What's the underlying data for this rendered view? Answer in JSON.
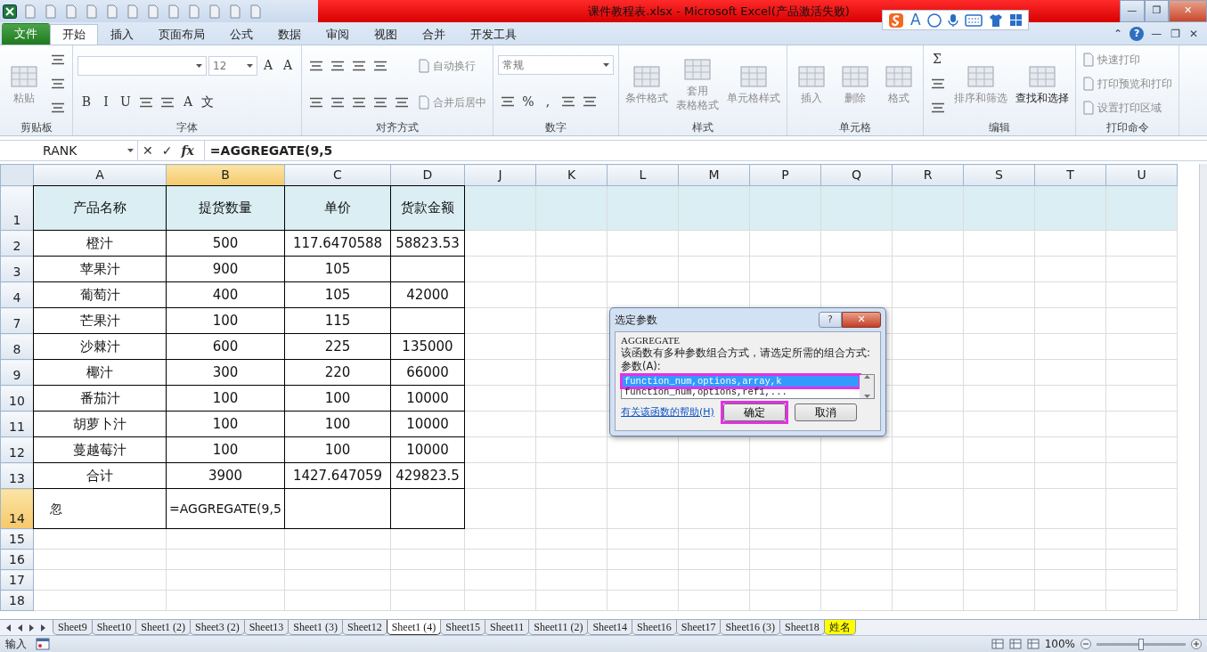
{
  "title_bar": {
    "title": "课件教程表.xlsx - Microsoft Excel(产品激活失败)",
    "controls": [
      "—",
      "❐",
      "✕"
    ]
  },
  "ime_toolbar": {
    "label": "A"
  },
  "ribbon_tabs": [
    {
      "label": "文件",
      "kind": "file",
      "selected": false
    },
    {
      "label": "开始",
      "kind": "tab",
      "selected": true
    },
    {
      "label": "插入",
      "kind": "tab",
      "selected": false
    },
    {
      "label": "页面布局",
      "kind": "tab",
      "selected": false
    },
    {
      "label": "公式",
      "kind": "tab",
      "selected": false
    },
    {
      "label": "数据",
      "kind": "tab",
      "selected": false
    },
    {
      "label": "审阅",
      "kind": "tab",
      "selected": false
    },
    {
      "label": "视图",
      "kind": "tab",
      "selected": false
    },
    {
      "label": "合并",
      "kind": "tab",
      "selected": false
    },
    {
      "label": "开发工具",
      "kind": "tab",
      "selected": false
    }
  ],
  "ribbon_controls": [
    "⌃",
    "?",
    "—",
    "❐",
    "✕"
  ],
  "ribbon": {
    "groups": [
      {
        "label": "剪贴板",
        "columns": [
          [
            [
              {
                "kind": "large",
                "label": "粘贴",
                "disabled": true
              }
            ]
          ],
          [
            [
              {
                "kind": "tool"
              }
            ],
            [
              {
                "kind": "tool"
              }
            ],
            [
              {
                "kind": "tool"
              }
            ]
          ]
        ]
      },
      {
        "label": "字体",
        "columns": [
          [
            [
              {
                "kind": "field"
              },
              {
                "kind": "field",
                "value": "12"
              },
              {
                "kind": "tool",
                "label": "A"
              },
              {
                "kind": "tool",
                "label": "A"
              }
            ],
            [
              {
                "kind": "tool",
                "label": "B"
              },
              {
                "kind": "tool",
                "label": "I"
              },
              {
                "kind": "tool",
                "label": "U"
              },
              {
                "kind": "tool"
              },
              {
                "kind": "tool"
              },
              {
                "kind": "tool",
                "label": "A"
              },
              {
                "kind": "tool",
                "label": "文"
              }
            ]
          ]
        ]
      },
      {
        "label": "对齐方式",
        "columns": [
          [
            [
              {
                "kind": "tool"
              },
              {
                "kind": "tool"
              },
              {
                "kind": "tool"
              },
              {
                "kind": "tool"
              }
            ],
            [
              {
                "kind": "tool"
              },
              {
                "kind": "tool"
              },
              {
                "kind": "tool"
              },
              {
                "kind": "tool"
              },
              {
                "kind": "tool"
              }
            ]
          ],
          [
            [
              {
                "kind": "small",
                "label": "自动换行",
                "disabled": true
              }
            ],
            [
              {
                "kind": "small",
                "label": "合并后居中",
                "disabled": true
              }
            ]
          ]
        ]
      },
      {
        "label": "数字",
        "columns": [
          [
            [
              {
                "kind": "field",
                "value": "常规"
              }
            ],
            [
              {
                "kind": "tool"
              },
              {
                "kind": "tool",
                "label": "%"
              },
              {
                "kind": "tool",
                "label": ","
              },
              {
                "kind": "tool"
              },
              {
                "kind": "tool"
              }
            ]
          ]
        ]
      },
      {
        "label": "样式",
        "columns": [
          [
            [
              {
                "kind": "large",
                "label": "条件格式",
                "disabled": true
              }
            ]
          ],
          [
            [
              {
                "kind": "large",
                "label": [
                  "套用",
                  "表格格式"
                ],
                "disabled": true
              }
            ]
          ],
          [
            [
              {
                "kind": "large",
                "label": "单元格样式",
                "disabled": true
              }
            ]
          ]
        ]
      },
      {
        "label": "单元格",
        "columns": [
          [
            [
              {
                "kind": "large",
                "label": "插入",
                "disabled": true
              }
            ]
          ],
          [
            [
              {
                "kind": "large",
                "label": "删除",
                "disabled": true
              }
            ]
          ],
          [
            [
              {
                "kind": "large",
                "label": "格式",
                "disabled": true
              }
            ]
          ]
        ]
      },
      {
        "label": "编辑",
        "columns": [
          [
            [
              {
                "kind": "tool",
                "label": "Σ"
              }
            ],
            [
              {
                "kind": "tool"
              }
            ],
            [
              {
                "kind": "tool"
              }
            ]
          ],
          [
            [
              {
                "kind": "large",
                "label": "排序和筛选",
                "disabled": true
              }
            ]
          ],
          [
            [
              {
                "kind": "large",
                "label": "查找和选择",
                "disabled": false
              }
            ]
          ]
        ]
      },
      {
        "label": "打印命令",
        "columns": [
          [
            [
              {
                "kind": "small",
                "label": "快速打印",
                "disabled": true
              }
            ],
            [
              {
                "kind": "small",
                "label": "打印预览和打印",
                "disabled": true
              }
            ],
            [
              {
                "kind": "small",
                "label": "设置打印区域",
                "disabled": true
              }
            ]
          ]
        ]
      }
    ]
  },
  "formula_bar": {
    "name_box": "RANK",
    "buttons": [
      "✕",
      "✓",
      "fx"
    ],
    "formula": "=AGGREGATE(9,5"
  },
  "sheet": {
    "columns": [
      {
        "label": "A",
        "selected": false
      },
      {
        "label": "B",
        "selected": true
      },
      {
        "label": "C",
        "selected": false
      },
      {
        "label": "D",
        "selected": false
      },
      {
        "label": "J",
        "selected": false
      },
      {
        "label": "K",
        "selected": false
      },
      {
        "label": "L",
        "selected": false
      },
      {
        "label": "M",
        "selected": false
      },
      {
        "label": "P",
        "selected": false
      },
      {
        "label": "Q",
        "selected": false
      },
      {
        "label": "R",
        "selected": false
      },
      {
        "label": "S",
        "selected": false
      },
      {
        "label": "T",
        "selected": false
      },
      {
        "label": "U",
        "selected": false
      }
    ],
    "rows": [
      {
        "header": "1",
        "kind": "header",
        "selected": false,
        "cells": [
          "产品名称",
          "提货数量",
          "单价",
          "货款金额"
        ]
      },
      {
        "header": "2",
        "kind": "data",
        "selected": false,
        "cells": [
          "橙汁",
          "500",
          "117.6470588",
          "58823.53"
        ]
      },
      {
        "header": "3",
        "kind": "data",
        "selected": false,
        "cells": [
          "苹果汁",
          "900",
          "105",
          null
        ]
      },
      {
        "header": "4",
        "kind": "data",
        "selected": false,
        "cells": [
          "葡萄汁",
          "400",
          "105",
          "42000"
        ]
      },
      {
        "header": "7",
        "kind": "data",
        "selected": false,
        "cells": [
          "芒果汁",
          "100",
          "115",
          null
        ]
      },
      {
        "header": "8",
        "kind": "data",
        "selected": false,
        "cells": [
          "沙棘汁",
          "600",
          "225",
          "135000"
        ]
      },
      {
        "header": "9",
        "kind": "data",
        "selected": false,
        "cells": [
          "椰汁",
          "300",
          "220",
          "66000"
        ]
      },
      {
        "header": "10",
        "kind": "data",
        "selected": false,
        "cells": [
          "番茄汁",
          "100",
          "100",
          "10000"
        ]
      },
      {
        "header": "11",
        "kind": "data",
        "selected": false,
        "cells": [
          "胡萝卜汁",
          "100",
          "100",
          "10000"
        ]
      },
      {
        "header": "12",
        "kind": "data",
        "selected": false,
        "cells": [
          "蔓越莓汁",
          "100",
          "100",
          "10000"
        ]
      },
      {
        "header": "13",
        "kind": "data",
        "selected": false,
        "cells": [
          "合计",
          "3900",
          "1427.647059",
          "429823.5"
        ]
      },
      {
        "header": "14",
        "kind": "input",
        "selected": true,
        "cells": [
          "忽",
          "=AGGREGATE(9,5",
          null,
          null
        ]
      },
      {
        "header": "15",
        "kind": "empty",
        "selected": false
      },
      {
        "header": "16",
        "kind": "empty",
        "selected": false
      },
      {
        "header": "17",
        "kind": "empty",
        "selected": false
      },
      {
        "header": "18",
        "kind": "empty",
        "selected": false
      }
    ]
  },
  "dialog": {
    "title": "选定参数",
    "title_buttons": [
      "?",
      "✕"
    ],
    "function": "AGGREGATE",
    "description": "该函数有多种参数组合方式，请选定所需的组合方式:",
    "list_label": "参数(A):",
    "options": [
      {
        "label": "function_num,options,array,k",
        "selected": true,
        "highlighted": true
      },
      {
        "label": "function_num,options,ref1,...",
        "selected": false,
        "highlighted": false
      }
    ],
    "help_link": "有关该函数的帮助(H)",
    "buttons": [
      {
        "label": "确定",
        "highlighted": true
      },
      {
        "label": "取消",
        "highlighted": false
      }
    ]
  },
  "sheet_tabs": [
    {
      "label": "Sheet9",
      "selected": false
    },
    {
      "label": "Sheet10",
      "selected": false
    },
    {
      "label": "Sheet1 (2)",
      "selected": false
    },
    {
      "label": "Sheet3 (2)",
      "selected": false
    },
    {
      "label": "Sheet13",
      "selected": false
    },
    {
      "label": "Sheet1 (3)",
      "selected": false
    },
    {
      "label": "Sheet12",
      "selected": false
    },
    {
      "label": "Sheet1 (4)",
      "selected": true
    },
    {
      "label": "Sheet15",
      "selected": false
    },
    {
      "label": "Sheet11",
      "selected": false
    },
    {
      "label": "Sheet11 (2)",
      "selected": false
    },
    {
      "label": "Sheet14",
      "selected": false
    },
    {
      "label": "Sheet16",
      "selected": false
    },
    {
      "label": "Sheet17",
      "selected": false
    },
    {
      "label": "Sheet16 (3)",
      "selected": false
    },
    {
      "label": "Sheet18",
      "selected": false
    },
    {
      "label": "姓名",
      "selected": false,
      "color": "#ffff00"
    }
  ],
  "status_bar": {
    "mode": "输入",
    "zoom": "100%",
    "zoom_slider": {
      "level": 0.5
    }
  }
}
